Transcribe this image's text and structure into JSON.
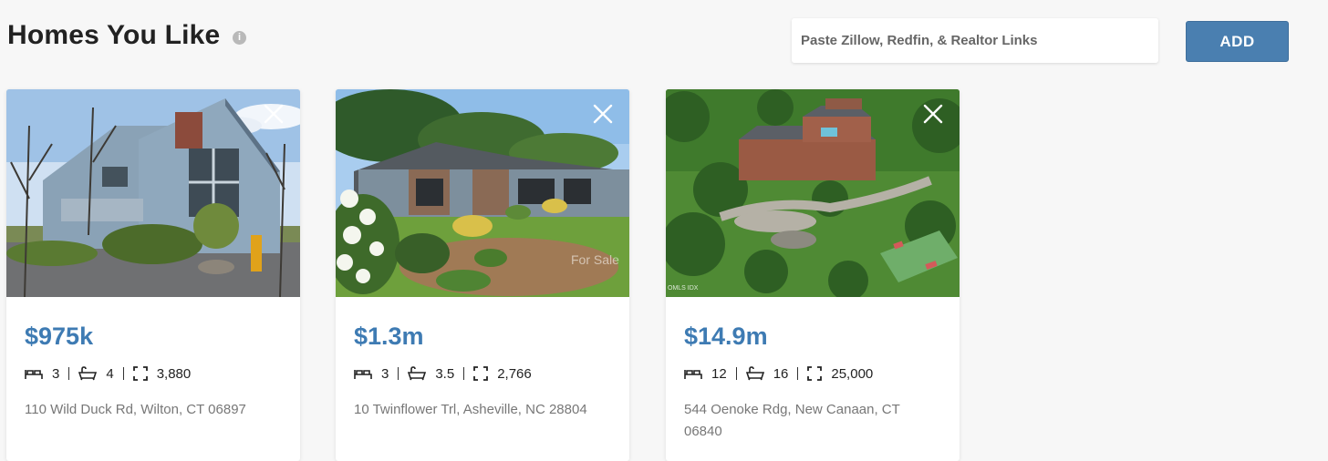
{
  "header": {
    "title": "Homes You Like",
    "info_glyph": "i",
    "link_input_placeholder": "Paste Zillow, Redfin, & Realtor Links",
    "add_label": "ADD"
  },
  "colors": {
    "price": "#3e7bb3",
    "add_button": "#4a7fb0",
    "background": "#f7f7f7"
  },
  "icons": {
    "info": "info-icon",
    "remove": "close-icon",
    "beds": "bed-icon",
    "baths": "bathtub-icon",
    "area": "square-footage-icon"
  },
  "listings": [
    {
      "price": "$975k",
      "beds": "3",
      "baths": "4",
      "sqft": "3,880",
      "address": "110 Wild Duck Rd, Wilton, CT 06897",
      "photo_watermark": ""
    },
    {
      "price": "$1.3m",
      "beds": "3",
      "baths": "3.5",
      "sqft": "2,766",
      "address": "10 Twinflower Trl, Asheville, NC 28804",
      "photo_watermark": "For Sale"
    },
    {
      "price": "$14.9m",
      "beds": "12",
      "baths": "16",
      "sqft": "25,000",
      "address": "544 Oenoke Rdg, New Canaan, CT 06840",
      "photo_watermark": "OMLS IDX"
    }
  ]
}
